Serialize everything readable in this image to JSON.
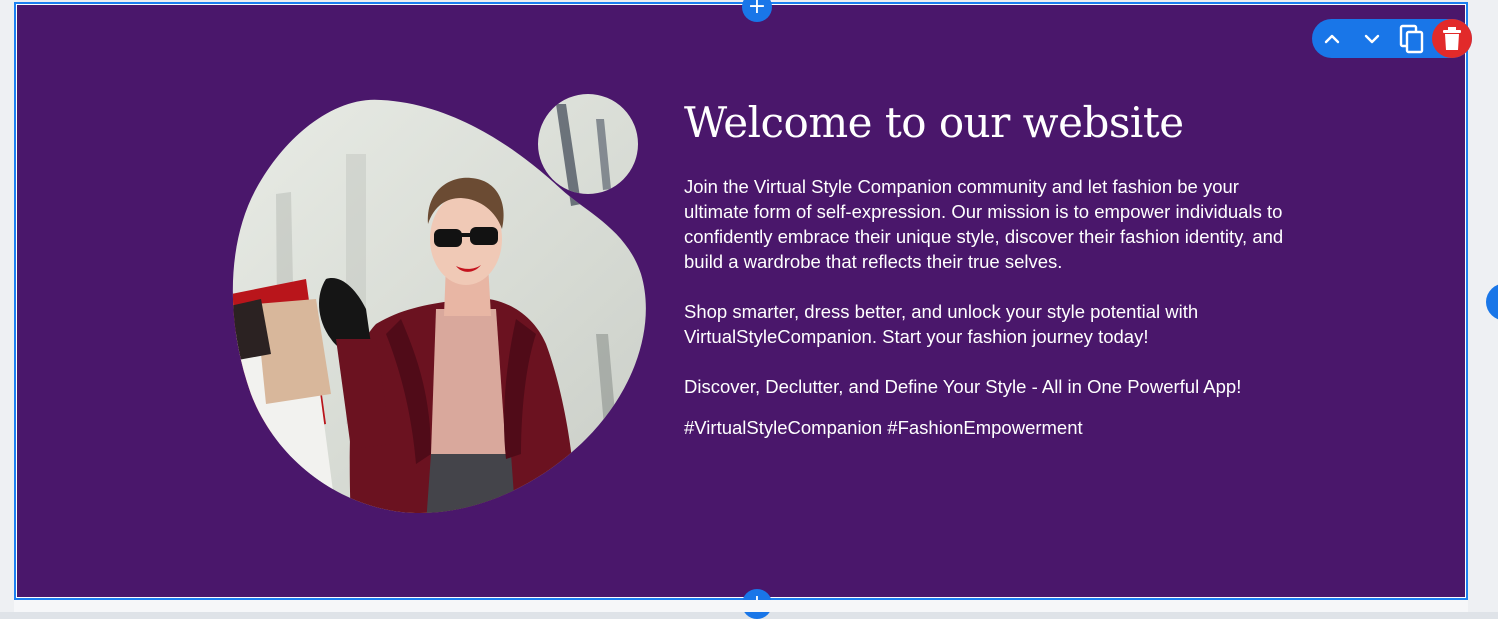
{
  "editor": {
    "add_section_symbol": "+",
    "toolbar": {
      "move_up_icon": "chevron-up-icon",
      "move_down_icon": "chevron-down-icon",
      "duplicate_icon": "copy-icon",
      "delete_icon": "trash-icon"
    },
    "colors": {
      "accent": "#1976e8",
      "delete": "#e22a2a",
      "section_bg": "#4a176b"
    }
  },
  "hero": {
    "heading": "Welcome to our website",
    "paragraph_1": "Join the Virtual Style Companion community and let fashion be your ultimate form of self-expression. Our mission is to empower individuals to confidently embrace their unique style, discover their fashion identity, and build a wardrobe that reflects their true selves.",
    "paragraph_2": "Shop smarter, dress better, and unlock your style potential with VirtualStyleCompanion. Start your fashion journey today!",
    "paragraph_3": "Discover, Declutter, and Define Your Style - All in One Powerful App!",
    "hashtags": "#VirtualStyleCompanion #FashionEmpowerment"
  }
}
